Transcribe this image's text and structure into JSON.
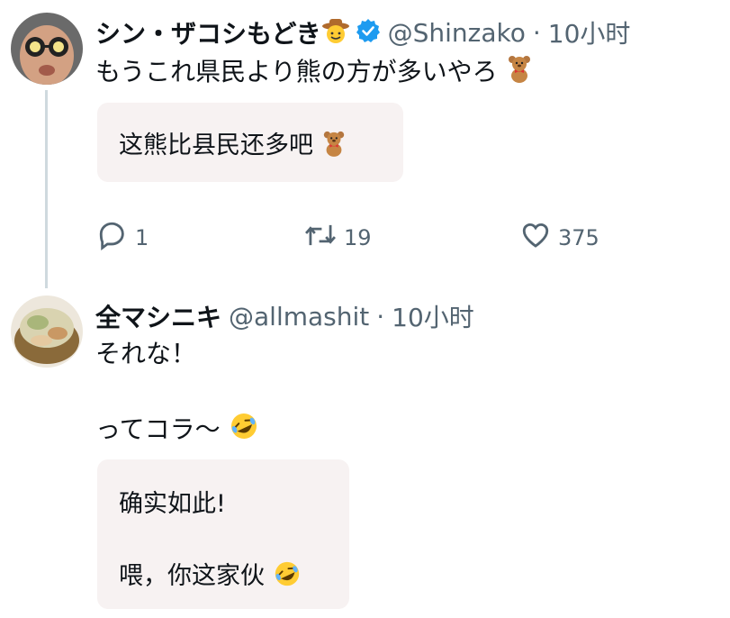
{
  "post1": {
    "author_name": "シン・ザコシもどき",
    "author_handle": "@Shinzako",
    "separator": "·",
    "time": "10小时",
    "text": "もうこれ県民より熊の方が多いやろ",
    "translation": "这熊比县民还多吧",
    "actions": {
      "replies": "1",
      "retweets": "19",
      "likes": "375"
    }
  },
  "post2": {
    "author_name": "全マシニキ",
    "author_handle": "@allmashit",
    "separator": "·",
    "time": "10小时",
    "text_line1": "それな！",
    "text_line2": "ってコラ〜",
    "translation_line1": "确实如此!",
    "translation_line2": "喂，你这家伙"
  },
  "colors": {
    "verified": "#1d9bf0",
    "muted": "#536471",
    "thread_line": "#cfd9de",
    "translation_bg": "#f7f2f2"
  },
  "icons": [
    "cowboy-emoji-icon",
    "verified-badge-icon",
    "teddy-bear-icon",
    "reply-icon",
    "retweet-icon",
    "like-icon",
    "rofl-emoji-icon"
  ]
}
